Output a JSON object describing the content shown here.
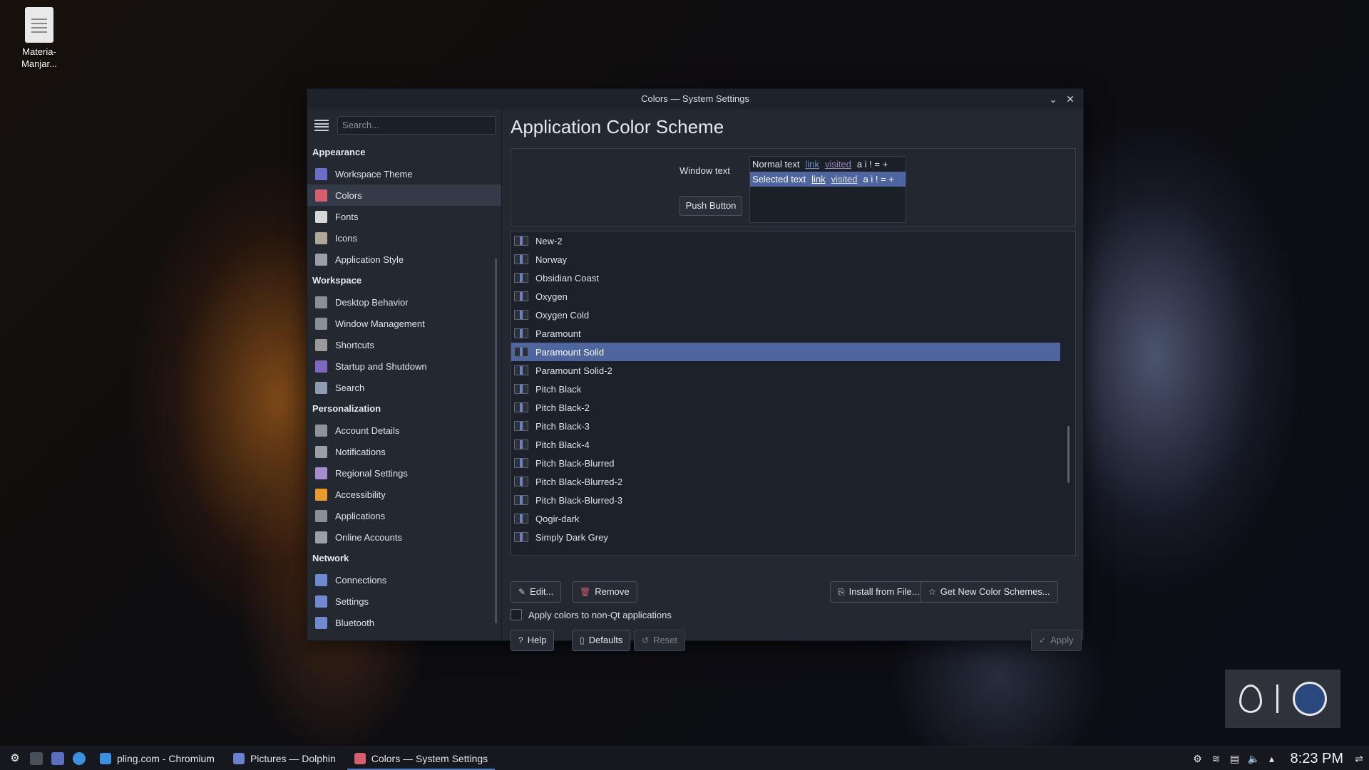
{
  "desktop": {
    "icon_label_line1": "Materia-",
    "icon_label_line2": "Manjar..."
  },
  "window": {
    "title": "Colors — System Settings",
    "minimize_glyph": "⌄",
    "close_glyph": "✕"
  },
  "sidebar": {
    "search_placeholder": "Search...",
    "categories": [
      {
        "label": "Appearance",
        "items": [
          {
            "label": "Workspace Theme",
            "color": "#6a6ec8"
          },
          {
            "label": "Colors",
            "color": "#d45f6e"
          },
          {
            "label": "Fonts",
            "color": "#d8d8d8"
          },
          {
            "label": "Icons",
            "color": "#b0a79a"
          },
          {
            "label": "Application Style",
            "color": "#9aa0aa"
          }
        ]
      },
      {
        "label": "Workspace",
        "items": [
          {
            "label": "Desktop Behavior",
            "color": "#8a8f98"
          },
          {
            "label": "Window Management",
            "color": "#8a8f98"
          },
          {
            "label": "Shortcuts",
            "color": "#9a9a9a"
          },
          {
            "label": "Startup and Shutdown",
            "color": "#7d6ac0"
          },
          {
            "label": "Search",
            "color": "#8e9bb0"
          }
        ]
      },
      {
        "label": "Personalization",
        "items": [
          {
            "label": "Account Details",
            "color": "#8e939c"
          },
          {
            "label": "Notifications",
            "color": "#9aa0aa"
          },
          {
            "label": "Regional Settings",
            "color": "#a58bd0"
          },
          {
            "label": "Accessibility",
            "color": "#e89a2c"
          },
          {
            "label": "Applications",
            "color": "#8a8f98"
          },
          {
            "label": "Online Accounts",
            "color": "#9aa0aa"
          }
        ]
      },
      {
        "label": "Network",
        "items": [
          {
            "label": "Connections",
            "color": "#6f8ad0"
          },
          {
            "label": "Settings",
            "color": "#6f8ad0"
          },
          {
            "label": "Bluetooth",
            "color": "#6f8ad0"
          }
        ]
      }
    ]
  },
  "main": {
    "title": "Application Color Scheme",
    "preview": {
      "window_text_label": "Window text",
      "push_button": "Push Button",
      "normal_text": "Normal text",
      "selected_text": "Selected text",
      "link": "link",
      "visited": "visited",
      "symbols": "a i ! = +"
    },
    "schemes": [
      {
        "name": "New-2",
        "selected": false
      },
      {
        "name": "Norway",
        "selected": false
      },
      {
        "name": "Obsidian Coast",
        "selected": false
      },
      {
        "name": "Oxygen",
        "selected": false
      },
      {
        "name": "Oxygen Cold",
        "selected": false
      },
      {
        "name": "Paramount",
        "selected": false
      },
      {
        "name": "Paramount Solid",
        "selected": true
      },
      {
        "name": "Paramount Solid-2",
        "selected": false
      },
      {
        "name": "Pitch Black",
        "selected": false
      },
      {
        "name": "Pitch Black-2",
        "selected": false
      },
      {
        "name": "Pitch Black-3",
        "selected": false
      },
      {
        "name": "Pitch Black-4",
        "selected": false
      },
      {
        "name": "Pitch Black-Blurred",
        "selected": false
      },
      {
        "name": "Pitch Black-Blurred-2",
        "selected": false
      },
      {
        "name": "Pitch Black-Blurred-3",
        "selected": false
      },
      {
        "name": "Qogir-dark",
        "selected": false
      },
      {
        "name": "Simply Dark Grey",
        "selected": false
      }
    ],
    "buttons": {
      "edit": "Edit...",
      "remove": "Remove",
      "install": "Install from File...",
      "get_new": "Get New Color Schemes...",
      "help": "Help",
      "defaults": "Defaults",
      "reset": "Reset",
      "apply": "Apply"
    },
    "apply_non_qt": "Apply colors to non-Qt applications"
  },
  "taskbar": {
    "tasks": [
      {
        "label": "pling.com - Chromium",
        "active": false,
        "color": "#3d8fe0"
      },
      {
        "label": "Pictures — Dolphin",
        "active": false,
        "color": "#6a7fd0"
      },
      {
        "label": "Colors  — System Settings",
        "active": true,
        "color": "#d45f6e"
      }
    ],
    "clock": "8:23 PM"
  }
}
